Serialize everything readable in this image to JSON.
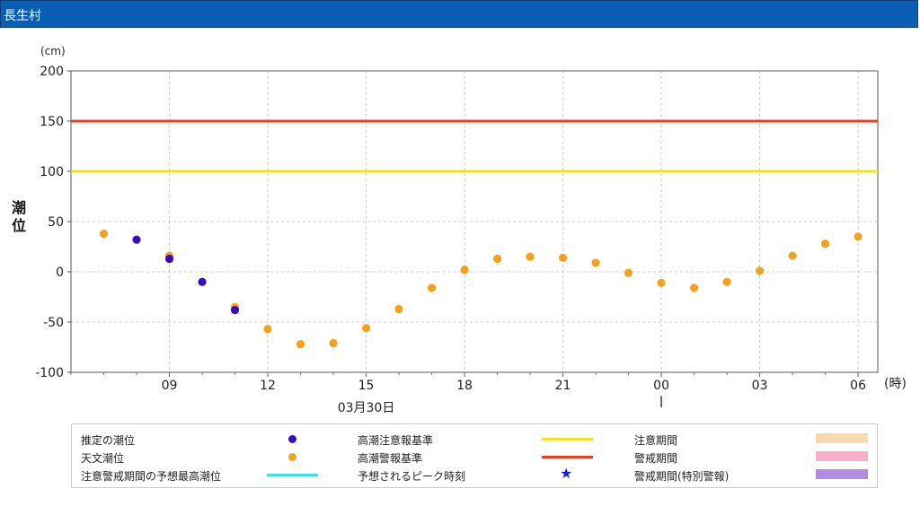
{
  "window": {
    "title": "長生村"
  },
  "chart_data": {
    "type": "scatter",
    "y_unit": "(cm)",
    "ylabel": "潮位",
    "x_unit": "(時)",
    "ylim": [
      -100,
      200
    ],
    "yticks": [
      200,
      150,
      100,
      50,
      0,
      -50,
      -100
    ],
    "xlim": [
      6,
      30.6
    ],
    "xticks": [
      {
        "x": 9,
        "label": "09"
      },
      {
        "x": 12,
        "label": "12"
      },
      {
        "x": 15,
        "label": "15"
      },
      {
        "x": 18,
        "label": "18"
      },
      {
        "x": 21,
        "label": "21"
      },
      {
        "x": 24,
        "label": "00"
      },
      {
        "x": 27,
        "label": "03"
      },
      {
        "x": 30,
        "label": "06"
      }
    ],
    "date_label": "03月30日",
    "date_x": 15,
    "day_boundary_x": 24,
    "thresholds": [
      {
        "name": "高潮警報基準",
        "value": 150,
        "color": "#e8401c"
      },
      {
        "name": "高潮注意報基準",
        "value": 100,
        "color": "#f2e21a"
      }
    ],
    "series": [
      {
        "name": "天文潮位",
        "color": "#f4a11d",
        "x": [
          7,
          9,
          11,
          12,
          13,
          14,
          15,
          16,
          17,
          18,
          19,
          20,
          21,
          22,
          23,
          24,
          25,
          26,
          27,
          28,
          29,
          30
        ],
        "y": [
          38,
          16,
          -35,
          -57,
          -72,
          -71,
          -56,
          -37,
          -16,
          2,
          13,
          15,
          14,
          9,
          -1,
          -11,
          -16,
          -10,
          1,
          16,
          28,
          35
        ]
      },
      {
        "name": "推定の潮位",
        "color": "#3b0bbf",
        "x": [
          8,
          9,
          10,
          11
        ],
        "y": [
          32,
          13,
          -10,
          -38
        ]
      }
    ]
  },
  "legend": {
    "items": [
      {
        "label": "推定の潮位",
        "kind": "dot",
        "color": "#3b0bbf"
      },
      {
        "label": "高潮注意報基準",
        "kind": "line",
        "color": "#f2e21a"
      },
      {
        "label": "注意期間",
        "kind": "swatch",
        "color": "#fbd9ae"
      },
      {
        "label": "天文潮位",
        "kind": "dot",
        "color": "#f4a11d"
      },
      {
        "label": "高潮警報基準",
        "kind": "line",
        "color": "#e8401c"
      },
      {
        "label": "警戒期間",
        "kind": "swatch",
        "color": "#f9aec9"
      },
      {
        "label": "注意警戒期間の予想最高潮位",
        "kind": "line",
        "color": "#3fe0e8"
      },
      {
        "label": "予想されるピーク時刻",
        "kind": "star",
        "color": "#1a1ad6",
        "icon": "star-icon"
      },
      {
        "label": "警戒期間(特別警報)",
        "kind": "swatch",
        "color": "#b18ce0"
      }
    ]
  }
}
